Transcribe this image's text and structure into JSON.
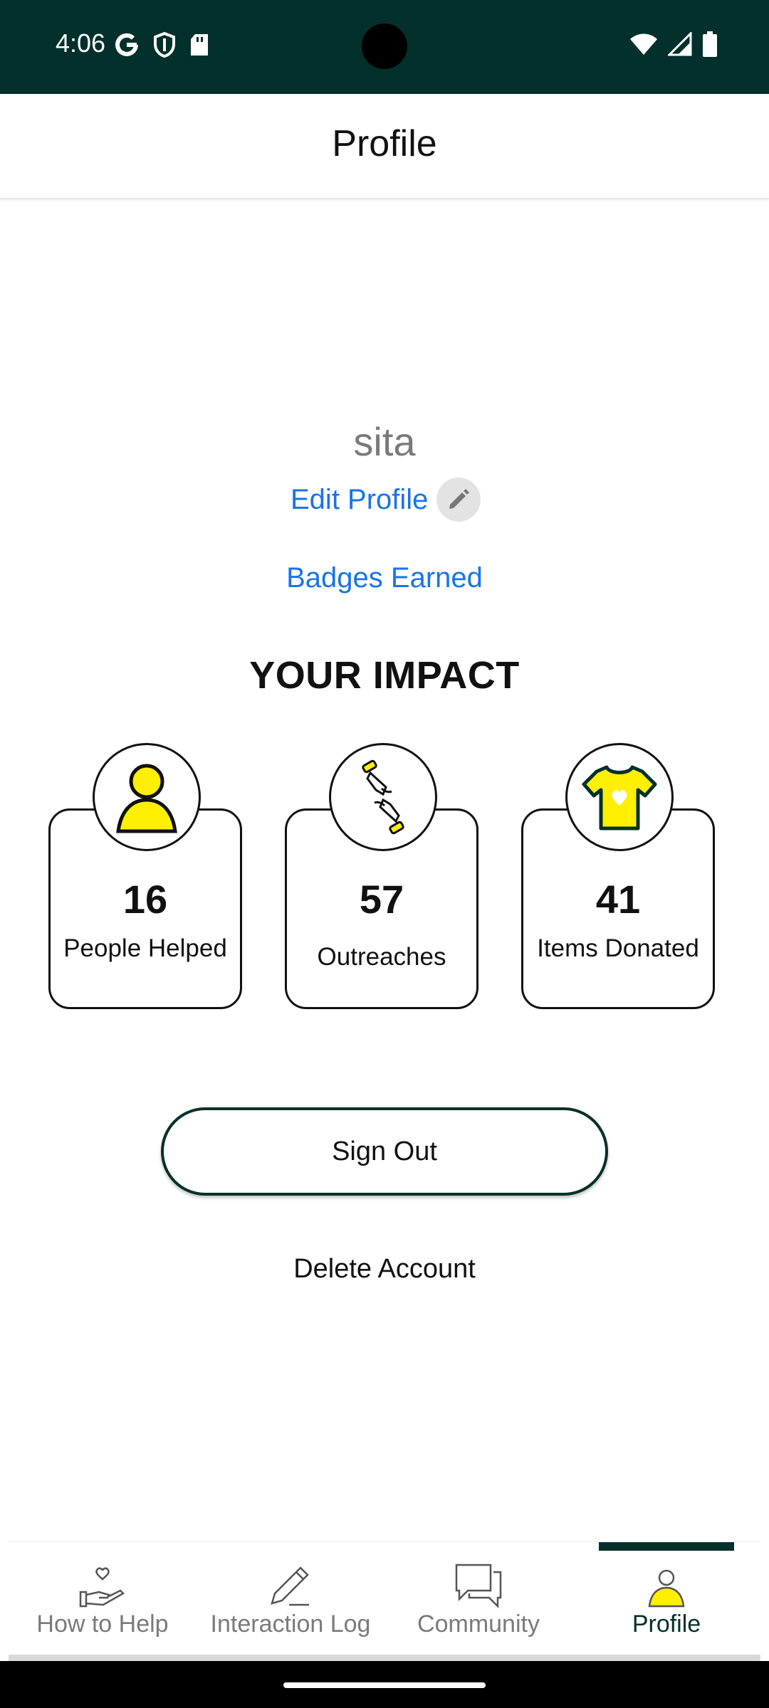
{
  "status_bar": {
    "time": "4:06",
    "left_icons": [
      "google-icon",
      "shield-icon",
      "sd-card-icon"
    ],
    "right_icons": [
      "wifi-icon",
      "signal-icon",
      "battery-icon"
    ]
  },
  "header": {
    "title": "Profile"
  },
  "profile": {
    "username": "sita",
    "edit_label": "Edit Profile",
    "badges_label": "Badges Earned"
  },
  "impact": {
    "title": "YOUR IMPACT",
    "stats": [
      {
        "value": "16",
        "label": "People Helped",
        "icon": "person-icon"
      },
      {
        "value": "57",
        "label": "Outreaches",
        "icon": "helping-hands-icon"
      },
      {
        "value": "41",
        "label": "Items Donated",
        "icon": "tshirt-heart-icon"
      }
    ]
  },
  "actions": {
    "sign_out": "Sign Out",
    "delete_account": "Delete Account"
  },
  "bottom_nav": {
    "items": [
      {
        "label": "How to Help",
        "icon": "hand-heart-icon",
        "active": false
      },
      {
        "label": "Interaction Log",
        "icon": "pencil-icon",
        "active": false
      },
      {
        "label": "Community",
        "icon": "chat-bubbles-icon",
        "active": false
      },
      {
        "label": "Profile",
        "icon": "person-icon",
        "active": true
      }
    ]
  },
  "colors": {
    "primary_dark": "#03302b",
    "accent_yellow": "#ffef00",
    "link_blue": "#1a73e8"
  }
}
